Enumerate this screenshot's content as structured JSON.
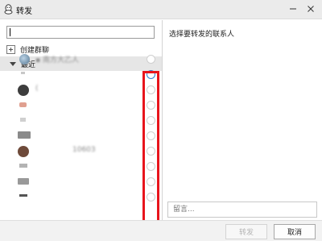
{
  "window": {
    "title": "转发",
    "app_icon": "penguin-icon",
    "minimize_icon": "minimize-icon",
    "close_icon": "close-icon"
  },
  "left": {
    "search_value": "",
    "create_group_label": "创建群聊",
    "create_group_icon": "plus-icon",
    "group_label": "最近",
    "group_toggle_icon": "triangle-down-icon",
    "contacts": [
      {
        "name": "▪ 南方大乙人",
        "selected": false,
        "hover": false
      },
      {
        "name": "",
        "selected": false,
        "hover": true
      },
      {
        "name": "(",
        "selected": false,
        "hover": false
      },
      {
        "name": "",
        "selected": false,
        "hover": false
      },
      {
        "name": "",
        "selected": false,
        "hover": false
      },
      {
        "name": "",
        "selected": false,
        "hover": false
      },
      {
        "name": "10603",
        "selected": false,
        "hover": false
      },
      {
        "name": "",
        "selected": false,
        "hover": false
      },
      {
        "name": "",
        "selected": false,
        "hover": false
      },
      {
        "name": "",
        "selected": false,
        "hover": false
      }
    ]
  },
  "right": {
    "title": "选择要转发的联系人",
    "message_placeholder": "留言..."
  },
  "footer": {
    "forward_label": "转发",
    "cancel_label": "取消"
  },
  "colors": {
    "highlight": "#e8141c",
    "hover_radio": "#2e7fd6",
    "titlebar": "#ebebeb",
    "group_header": "#e6e6e6"
  }
}
